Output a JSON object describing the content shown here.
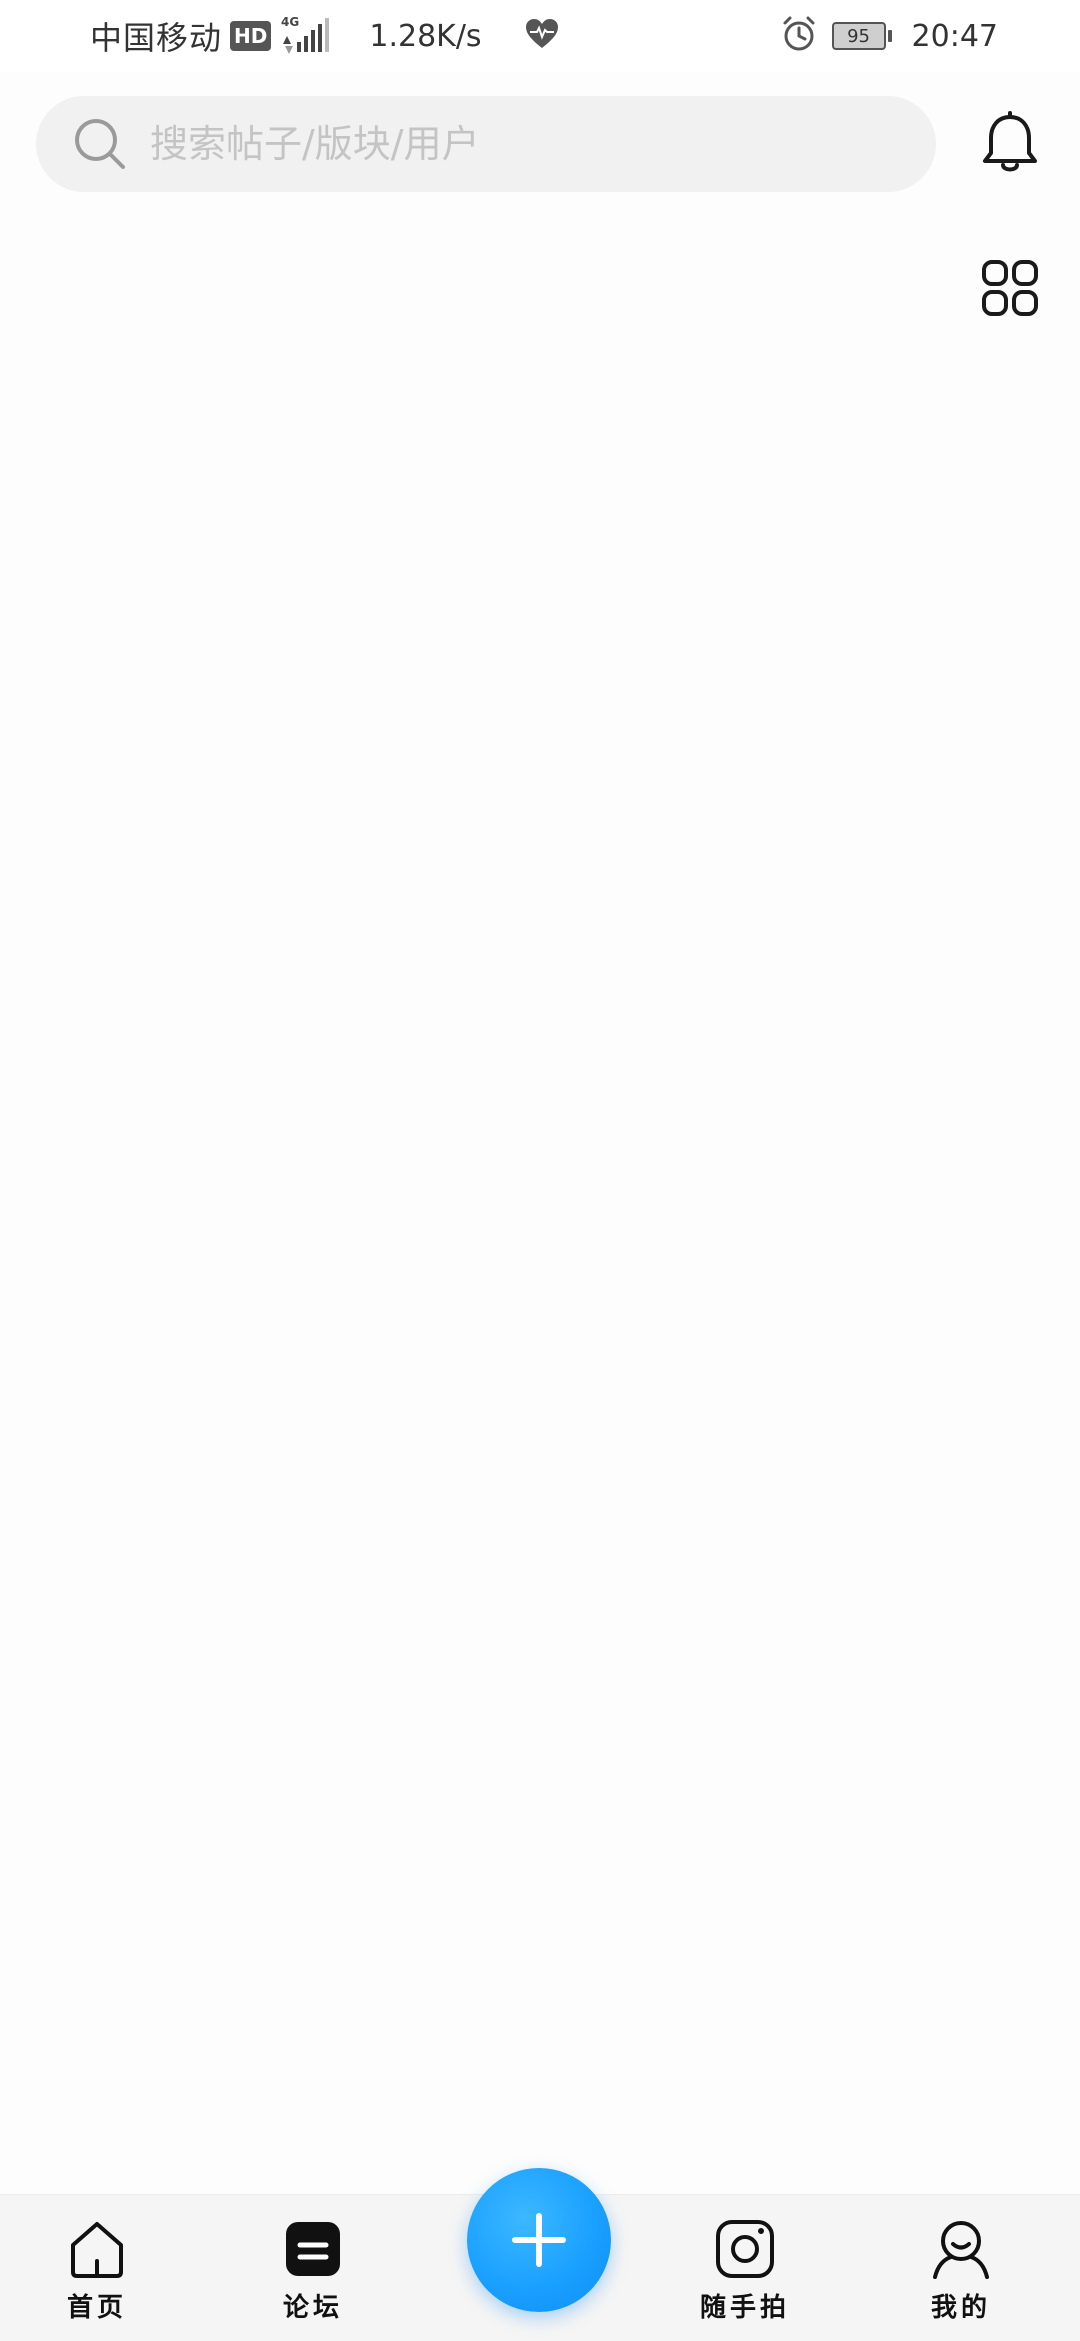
{
  "status_bar": {
    "carrier": "中国移动",
    "hd_badge": "HD",
    "network_type": "4G",
    "net_speed": "1.28K/s",
    "battery_level": "95",
    "time": "20:47"
  },
  "header": {
    "search_placeholder": "搜索帖子/版块/用户"
  },
  "nav": {
    "items": [
      {
        "label": "首页",
        "icon": "home-icon"
      },
      {
        "label": "论坛",
        "icon": "forum-icon"
      },
      {
        "label": "随手拍",
        "icon": "camera-icon"
      },
      {
        "label": "我的",
        "icon": "profile-icon"
      }
    ],
    "fab_icon": "plus-icon"
  },
  "colors": {
    "accent": "#1aa0ff",
    "search_bg": "#f1f1f1",
    "nav_bg": "#f5f5f5",
    "text": "#111111",
    "placeholder": "#c4c4c4"
  }
}
